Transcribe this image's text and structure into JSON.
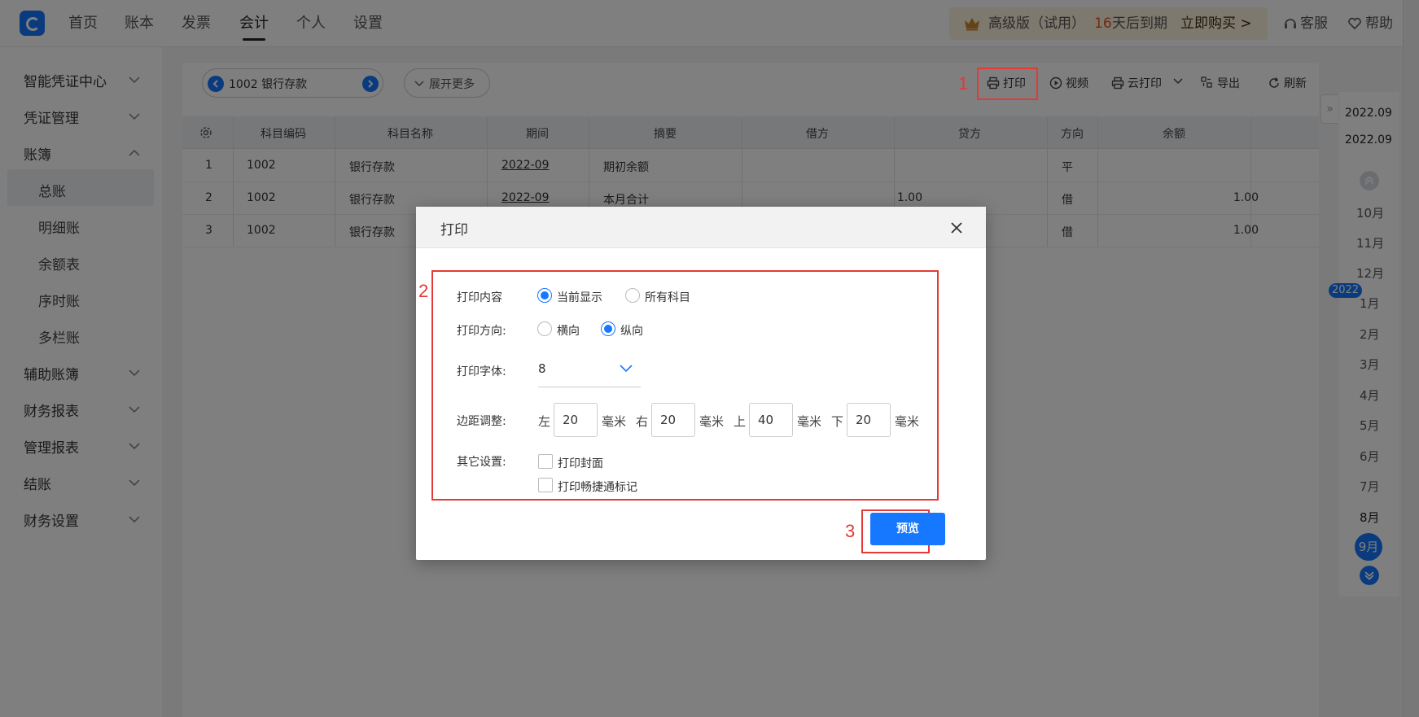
{
  "nav": {
    "items": [
      "首页",
      "账本",
      "发票",
      "会计",
      "个人",
      "设置"
    ],
    "active_index": 3
  },
  "trial": {
    "level": "高级版（试用）",
    "days": "16",
    "suffix": "天后到期",
    "buy": "立即购买 >"
  },
  "header_links": {
    "service": "客服",
    "help": "帮助"
  },
  "sidebar": {
    "groups": [
      "智能凭证中心",
      "凭证管理",
      "账簿",
      "辅助账簿",
      "财务报表",
      "管理报表",
      "结账",
      "财务设置"
    ],
    "sub_items": [
      "总账",
      "明细账",
      "余额表",
      "序时账",
      "多栏账"
    ],
    "active_sub": "总账"
  },
  "toolbar": {
    "account": "1002 银行存款",
    "expand": "展开更多",
    "print": "打印",
    "video": "视频",
    "cloud_print": "云打印",
    "export": "导出",
    "refresh": "刷新"
  },
  "table": {
    "headers": [
      "科目编码",
      "科目名称",
      "期间",
      "摘要",
      "借方",
      "贷方",
      "方向",
      "余额"
    ],
    "rows": [
      {
        "no": "1",
        "code": "1002",
        "name": "银行存款",
        "period": "2022-09",
        "summary": "期初余额",
        "debit": "",
        "credit": "",
        "dir": "平",
        "balance": ""
      },
      {
        "no": "2",
        "code": "1002",
        "name": "银行存款",
        "period": "2022-09",
        "summary": "本月合计",
        "debit": "1.00",
        "credit": "",
        "dir": "借",
        "balance": "1.00"
      },
      {
        "no": "3",
        "code": "1002",
        "name": "银行存款",
        "period": "",
        "summary": "",
        "debit": "",
        "credit": "",
        "dir": "借",
        "balance": "1.00"
      }
    ]
  },
  "date_panel": {
    "from": "2022.09",
    "to": "2022.09",
    "year": "2022",
    "months": [
      "10月",
      "11月",
      "12月",
      "1月",
      "2月",
      "3月",
      "4月",
      "5月",
      "6月",
      "7月",
      "8月"
    ],
    "active_month": "9月"
  },
  "markers": [
    "1",
    "2",
    "3"
  ],
  "dialog": {
    "title": "打印",
    "content_label": "打印内容",
    "content_options": [
      "当前显示",
      "所有科目"
    ],
    "orient_label": "打印方向:",
    "orient_options": [
      "横向",
      "纵向"
    ],
    "font_label": "打印字体:",
    "font_value": "8",
    "margin_label": "边距调整:",
    "margins": [
      {
        "side": "左",
        "value": "20"
      },
      {
        "side": "右",
        "value": "20"
      },
      {
        "side": "上",
        "value": "40"
      },
      {
        "side": "下",
        "value": "20"
      }
    ],
    "unit": "毫米",
    "other_label": "其它设置:",
    "other_options": [
      "打印封面",
      "打印畅捷通标记"
    ],
    "preview": "预览"
  },
  "colors": {
    "accent": "#1677ff",
    "marker": "#e53935",
    "trial_bg": "#fdf3dc"
  }
}
